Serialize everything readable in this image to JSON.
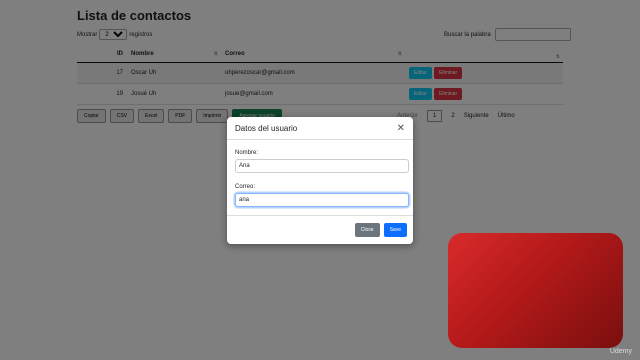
{
  "page_title": "Lista de contactos",
  "length": {
    "prefix": "Mostrar",
    "value": "2",
    "suffix": "registros"
  },
  "search_label": "Buscar la palabra",
  "table": {
    "headers": [
      "ID",
      "Nombre",
      "Correo",
      ""
    ],
    "rows": [
      {
        "id": "17",
        "name": "Oscar Uh",
        "email": "uhperezoscar@gmail.com"
      },
      {
        "id": "19",
        "name": "Josué Uh",
        "email": "josue@gmail.com"
      }
    ],
    "edit_label": "Editar",
    "delete_label": "Eliminar"
  },
  "export_buttons": [
    "Copiar",
    "CSV",
    "Excel",
    "PDF",
    "Imprimir"
  ],
  "add_button": "Agregar usuario",
  "pager": {
    "prev": "Anterior",
    "page1": "1",
    "page2": "2",
    "next": "Siguiente",
    "last": "Último"
  },
  "modal": {
    "title": "Datos del usuario",
    "name_label": "Nombre:",
    "name_value": "Ana",
    "email_label": "Correo:",
    "email_value": "ana",
    "close_label": "Close",
    "save_label": "Save"
  },
  "watermark": "Udemy"
}
